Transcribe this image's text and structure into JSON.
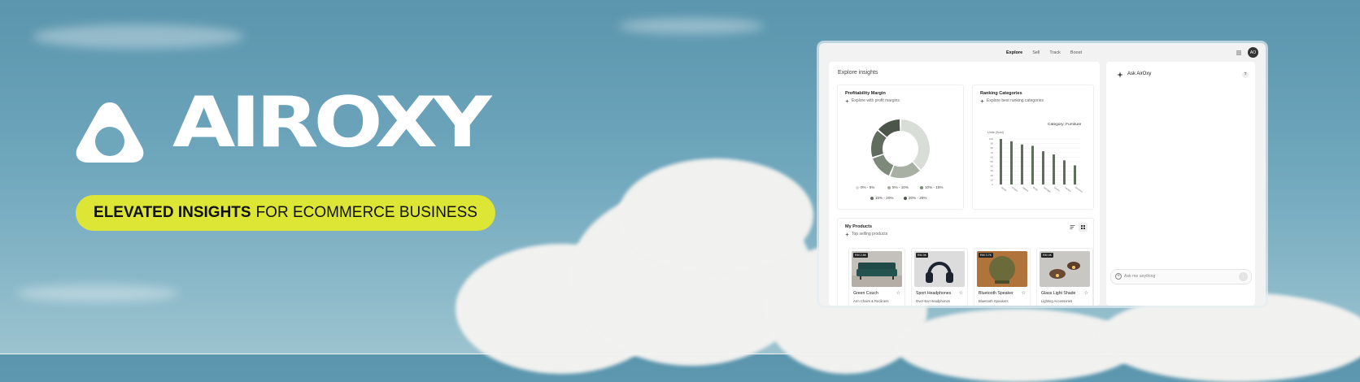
{
  "brand": {
    "wordmark": "AIROXY",
    "tagline_bold": "ELEVATED INSIGHTS",
    "tagline_rest": "FOR ECOMMERCE BUSINESS",
    "accent_color": "#dde535"
  },
  "app": {
    "nav": [
      "Explore",
      "Sell",
      "Track",
      "Boost"
    ],
    "nav_active": "Explore",
    "avatar_initials": "AO",
    "main_title": "Explore insights",
    "profitability": {
      "title": "Profitability Margin",
      "subtitle": "Explore with profit margins"
    },
    "ranking": {
      "title": "Ranking Categories",
      "subtitle": "Explore best ranking categories",
      "category_label": "Category: Furniture",
      "y_label": "Units (Sold)"
    },
    "products": {
      "title": "My Products",
      "subtitle": "Top selling products",
      "items": [
        {
          "tag": "RM 2.8K",
          "name": "Green Couch",
          "category": "Arm Chairs & Recliners"
        },
        {
          "tag": "RM 3K",
          "name": "Sport Headphones",
          "category": "Over-Ear Headphones"
        },
        {
          "tag": "RM 3.7K",
          "name": "Bluetooth Speaker",
          "category": "Bluetooth Speakers"
        },
        {
          "tag": "RM 4K",
          "name": "Glass Light Shade",
          "category": "Lighting Accessories"
        }
      ]
    },
    "assistant": {
      "title": "Ask AirOxy",
      "help": "?",
      "placeholder": "Ask me anything"
    }
  },
  "chart_data": [
    {
      "type": "pie",
      "title": "Profitability Margin",
      "labels": [
        "0% - 5%",
        "5% - 10%",
        "10% - 15%",
        "15% - 20%",
        "20% - 25%"
      ],
      "values": [
        38,
        18,
        14,
        16,
        14
      ],
      "colors": [
        "#d9ddd7",
        "#a7b0a3",
        "#7d8a7b",
        "#5f6c5e",
        "#4b554a"
      ]
    },
    {
      "type": "bar",
      "title": "Ranking Categories",
      "ylabel": "Units (Sold)",
      "categories": [
        "Sofas",
        "Chairs",
        "Tables",
        "Beds",
        "Storage",
        "Desks",
        "Lamps",
        "Shelves"
      ],
      "values": [
        100,
        95,
        88,
        85,
        73,
        66,
        53,
        42
      ],
      "ylim": [
        0,
        100
      ],
      "yticks": [
        0,
        10,
        20,
        30,
        40,
        50,
        60,
        70,
        80,
        90,
        100
      ],
      "color": "#5f6c5e"
    }
  ]
}
